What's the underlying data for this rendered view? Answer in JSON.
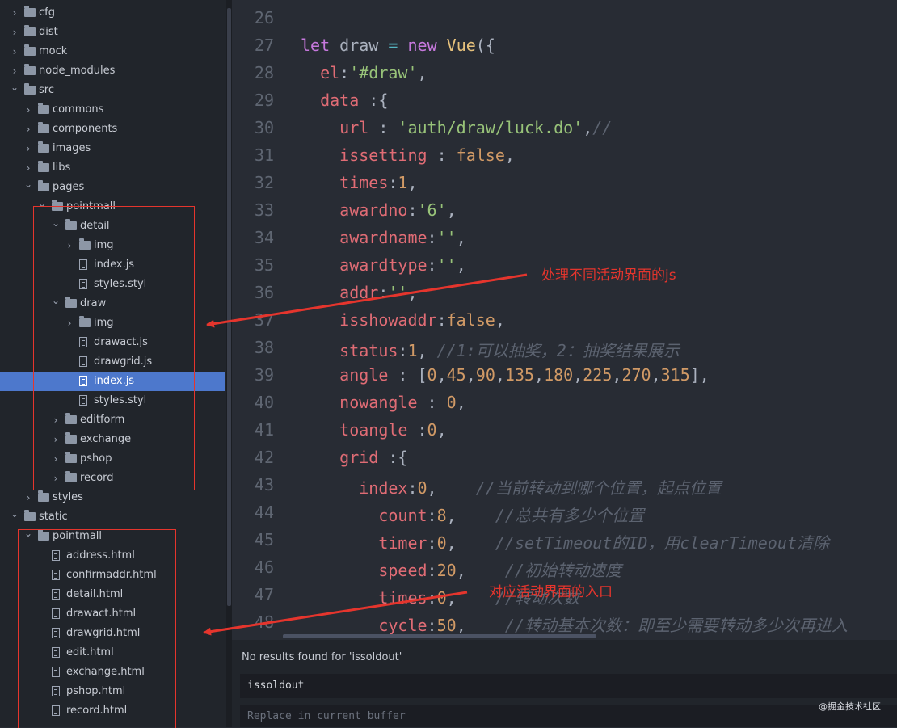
{
  "tree": [
    {
      "depth": 0,
      "type": "folder",
      "open": false,
      "label": "cfg"
    },
    {
      "depth": 0,
      "type": "folder",
      "open": false,
      "label": "dist"
    },
    {
      "depth": 0,
      "type": "folder",
      "open": false,
      "label": "mock"
    },
    {
      "depth": 0,
      "type": "folder",
      "open": false,
      "label": "node_modules"
    },
    {
      "depth": 0,
      "type": "folder",
      "open": true,
      "label": "src"
    },
    {
      "depth": 1,
      "type": "folder",
      "open": false,
      "label": "commons"
    },
    {
      "depth": 1,
      "type": "folder",
      "open": false,
      "label": "components"
    },
    {
      "depth": 1,
      "type": "folder",
      "open": false,
      "label": "images"
    },
    {
      "depth": 1,
      "type": "folder",
      "open": false,
      "label": "libs"
    },
    {
      "depth": 1,
      "type": "folder",
      "open": true,
      "label": "pages"
    },
    {
      "depth": 2,
      "type": "folder",
      "open": true,
      "label": "pointmall"
    },
    {
      "depth": 3,
      "type": "folder",
      "open": true,
      "label": "detail"
    },
    {
      "depth": 4,
      "type": "folder",
      "open": false,
      "label": "img"
    },
    {
      "depth": 4,
      "type": "file",
      "label": "index.js"
    },
    {
      "depth": 4,
      "type": "file",
      "label": "styles.styl"
    },
    {
      "depth": 3,
      "type": "folder",
      "open": true,
      "label": "draw"
    },
    {
      "depth": 4,
      "type": "folder",
      "open": false,
      "label": "img"
    },
    {
      "depth": 4,
      "type": "file",
      "label": "drawact.js"
    },
    {
      "depth": 4,
      "type": "file",
      "label": "drawgrid.js"
    },
    {
      "depth": 4,
      "type": "file",
      "label": "index.js",
      "selected": true
    },
    {
      "depth": 4,
      "type": "file",
      "label": "styles.styl"
    },
    {
      "depth": 3,
      "type": "folder",
      "open": false,
      "label": "editform"
    },
    {
      "depth": 3,
      "type": "folder",
      "open": false,
      "label": "exchange"
    },
    {
      "depth": 3,
      "type": "folder",
      "open": false,
      "label": "pshop"
    },
    {
      "depth": 3,
      "type": "folder",
      "open": false,
      "label": "record"
    },
    {
      "depth": 1,
      "type": "folder",
      "open": false,
      "label": "styles"
    },
    {
      "depth": 0,
      "type": "folder",
      "open": true,
      "label": "static"
    },
    {
      "depth": 1,
      "type": "folder",
      "open": true,
      "label": "pointmall"
    },
    {
      "depth": 2,
      "type": "file",
      "label": "address.html"
    },
    {
      "depth": 2,
      "type": "file",
      "label": "confirmaddr.html"
    },
    {
      "depth": 2,
      "type": "file",
      "label": "detail.html"
    },
    {
      "depth": 2,
      "type": "file",
      "label": "drawact.html"
    },
    {
      "depth": 2,
      "type": "file",
      "label": "drawgrid.html"
    },
    {
      "depth": 2,
      "type": "file",
      "label": "edit.html"
    },
    {
      "depth": 2,
      "type": "file",
      "label": "exchange.html"
    },
    {
      "depth": 2,
      "type": "file",
      "label": "pshop.html"
    },
    {
      "depth": 2,
      "type": "file",
      "label": "record.html"
    }
  ],
  "code_lines": [
    {
      "n": "26",
      "t": []
    },
    {
      "n": "27",
      "t": [
        [
          "k",
          "let "
        ],
        [
          "p",
          "draw "
        ],
        [
          "o",
          "= "
        ],
        [
          "k",
          "new "
        ],
        [
          "y",
          "Vue"
        ],
        [
          "p",
          "({"
        ]
      ]
    },
    {
      "n": "28",
      "t": [
        [
          "v",
          "  el"
        ],
        [
          "p",
          ":"
        ],
        [
          "s",
          "'#draw'"
        ],
        [
          "p",
          ","
        ]
      ]
    },
    {
      "n": "29",
      "t": [
        [
          "v",
          "  data "
        ],
        [
          "p",
          ":{"
        ]
      ]
    },
    {
      "n": "30",
      "t": [
        [
          "v",
          "    url "
        ],
        [
          "p",
          ": "
        ],
        [
          "s",
          "'auth/draw/luck.do'"
        ],
        [
          "p",
          ","
        ],
        [
          "c",
          "//"
        ]
      ]
    },
    {
      "n": "31",
      "t": [
        [
          "v",
          "    issetting "
        ],
        [
          "p",
          ": "
        ],
        [
          "n",
          "false"
        ],
        [
          "p",
          ","
        ]
      ]
    },
    {
      "n": "32",
      "t": [
        [
          "v",
          "    times"
        ],
        [
          "p",
          ":"
        ],
        [
          "n",
          "1"
        ],
        [
          "p",
          ","
        ]
      ]
    },
    {
      "n": "33",
      "t": [
        [
          "v",
          "    awardno"
        ],
        [
          "p",
          ":"
        ],
        [
          "s",
          "'6'"
        ],
        [
          "p",
          ","
        ]
      ]
    },
    {
      "n": "34",
      "t": [
        [
          "v",
          "    awardname"
        ],
        [
          "p",
          ":"
        ],
        [
          "s",
          "''"
        ],
        [
          "p",
          ","
        ]
      ]
    },
    {
      "n": "35",
      "t": [
        [
          "v",
          "    awardtype"
        ],
        [
          "p",
          ":"
        ],
        [
          "s",
          "''"
        ],
        [
          "p",
          ","
        ]
      ]
    },
    {
      "n": "36",
      "t": [
        [
          "v",
          "    addr"
        ],
        [
          "p",
          ":"
        ],
        [
          "s",
          "''"
        ],
        [
          "p",
          ","
        ]
      ]
    },
    {
      "n": "37",
      "t": [
        [
          "v",
          "    isshowaddr"
        ],
        [
          "p",
          ":"
        ],
        [
          "n",
          "false"
        ],
        [
          "p",
          ","
        ]
      ]
    },
    {
      "n": "38",
      "t": [
        [
          "v",
          "    status"
        ],
        [
          "p",
          ":"
        ],
        [
          "n",
          "1"
        ],
        [
          "p",
          ", "
        ],
        [
          "c",
          "//1:可以抽奖，2：抽奖结果展示"
        ]
      ]
    },
    {
      "n": "39",
      "t": [
        [
          "v",
          "    angle "
        ],
        [
          "p",
          ": ["
        ],
        [
          "n",
          "0"
        ],
        [
          "p",
          ","
        ],
        [
          "n",
          "45"
        ],
        [
          "p",
          ","
        ],
        [
          "n",
          "90"
        ],
        [
          "p",
          ","
        ],
        [
          "n",
          "135"
        ],
        [
          "p",
          ","
        ],
        [
          "n",
          "180"
        ],
        [
          "p",
          ","
        ],
        [
          "n",
          "225"
        ],
        [
          "p",
          ","
        ],
        [
          "n",
          "270"
        ],
        [
          "p",
          ","
        ],
        [
          "n",
          "315"
        ],
        [
          "p",
          "],"
        ]
      ]
    },
    {
      "n": "40",
      "t": [
        [
          "v",
          "    nowangle "
        ],
        [
          "p",
          ": "
        ],
        [
          "n",
          "0"
        ],
        [
          "p",
          ","
        ]
      ]
    },
    {
      "n": "41",
      "t": [
        [
          "v",
          "    toangle "
        ],
        [
          "p",
          ":"
        ],
        [
          "n",
          "0"
        ],
        [
          "p",
          ","
        ]
      ]
    },
    {
      "n": "42",
      "t": [
        [
          "v",
          "    grid "
        ],
        [
          "p",
          ":{"
        ]
      ]
    },
    {
      "n": "43",
      "t": [
        [
          "v",
          "      index"
        ],
        [
          "p",
          ":"
        ],
        [
          "n",
          "0"
        ],
        [
          "p",
          ",    "
        ],
        [
          "c",
          "//当前转动到哪个位置，起点位置"
        ]
      ]
    },
    {
      "n": "44",
      "t": [
        [
          "v",
          "        count"
        ],
        [
          "p",
          ":"
        ],
        [
          "n",
          "8"
        ],
        [
          "p",
          ",    "
        ],
        [
          "c",
          "//总共有多少个位置"
        ]
      ]
    },
    {
      "n": "45",
      "t": [
        [
          "v",
          "        timer"
        ],
        [
          "p",
          ":"
        ],
        [
          "n",
          "0"
        ],
        [
          "p",
          ",    "
        ],
        [
          "c",
          "//setTimeout的ID，用clearTimeout清除"
        ]
      ]
    },
    {
      "n": "46",
      "t": [
        [
          "v",
          "        speed"
        ],
        [
          "p",
          ":"
        ],
        [
          "n",
          "20"
        ],
        [
          "p",
          ",    "
        ],
        [
          "c",
          "//初始转动速度"
        ]
      ]
    },
    {
      "n": "47",
      "t": [
        [
          "v",
          "        times"
        ],
        [
          "p",
          ":"
        ],
        [
          "n",
          "0"
        ],
        [
          "p",
          ",    "
        ],
        [
          "c",
          "//转动次数"
        ]
      ]
    },
    {
      "n": "48",
      "t": [
        [
          "v",
          "        cycle"
        ],
        [
          "p",
          ":"
        ],
        [
          "n",
          "50"
        ],
        [
          "p",
          ",    "
        ],
        [
          "c",
          "//转动基本次数：即至少需要转动多少次再进入"
        ]
      ]
    }
  ],
  "find": {
    "message": "No results found for 'issoldout'",
    "search_value": "issoldout",
    "replace_placeholder": "Replace in current buffer"
  },
  "annotations": {
    "top": "处理不同活动界面的js",
    "bottom": "对应活动界面的入口"
  },
  "watermark": "@掘金技术社区",
  "colors": {
    "accent": "#e5352d",
    "selection": "#4d78cc"
  }
}
